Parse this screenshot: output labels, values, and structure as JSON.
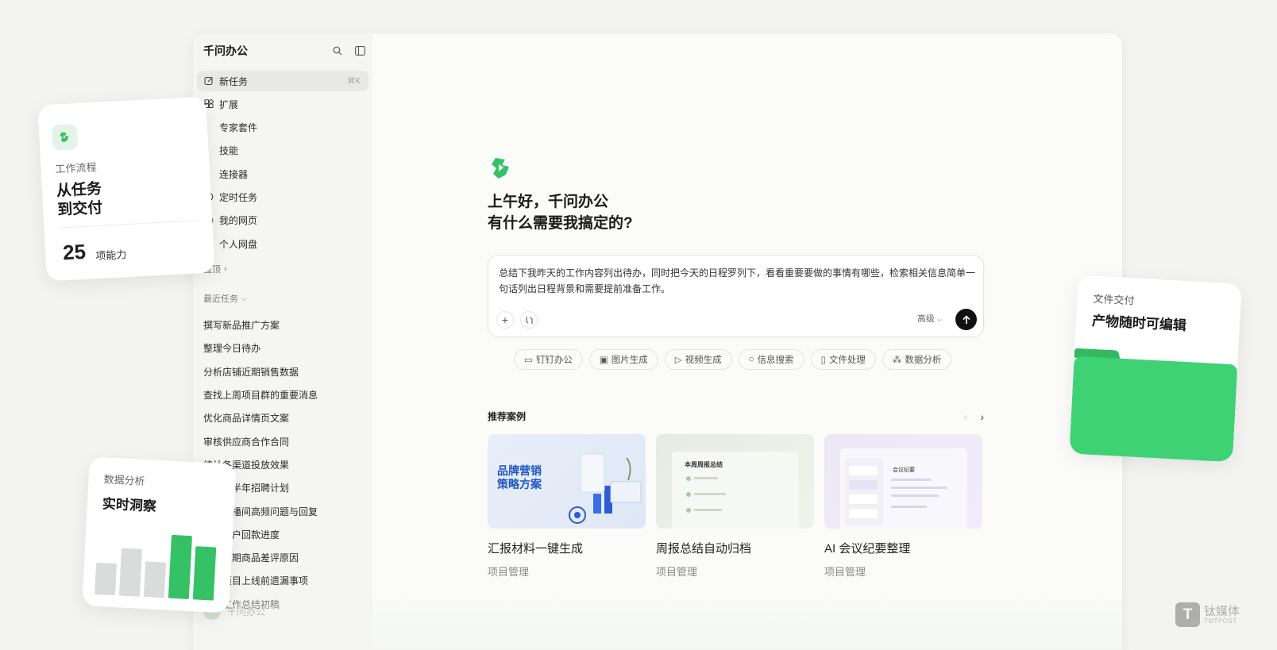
{
  "app": {
    "title": "千问办公",
    "accent": "#36c167"
  },
  "sidebar": {
    "items": [
      {
        "label": "新任务",
        "shortcut": "⌘K",
        "icon": "edit-icon"
      },
      {
        "label": "扩展",
        "icon": "extension-icon"
      },
      {
        "label": "专家套件",
        "icon": "suite-icon"
      },
      {
        "label": "技能",
        "icon": "skill-icon"
      },
      {
        "label": "连接器",
        "icon": "connector-icon"
      },
      {
        "label": "定时任务",
        "icon": "clock-icon"
      },
      {
        "label": "我的网页",
        "icon": "globe-icon"
      },
      {
        "label": "个人网盘",
        "icon": "drive-icon"
      }
    ],
    "pinned_label": "置顶",
    "recent_label": "最近任务",
    "recent_tasks": [
      "撰写新品推广方案",
      "整理今日待办",
      "分析店铺近期销售数据",
      "查找上周项目群的重要消息",
      "优化商品详情页文案",
      "审核供应商合作合同",
      "统计各渠道投放效果",
      "制定下半年招聘计划",
      "整理直播间高频问题与回复",
      "盘点客户回款进度",
      "分析近期商品差评原因",
      "梳理项目上线前遗漏事项",
      "季度工作总结初稿"
    ],
    "user_name": "千问办公"
  },
  "main": {
    "greeting_line1": "上午好，千问办公",
    "greeting_line2": "有什么需要我搞定的?",
    "composer_text": "总结下我昨天的工作内容列出待办，同时把今天的日程罗列下，看看重要要做的事情有哪些，检索相关信息简单一句话列出日程背景和需要提前准备工作。",
    "advanced_label": "高级",
    "chips": [
      {
        "label": "钉钉办公",
        "icon": "laptop-icon"
      },
      {
        "label": "图片生成",
        "icon": "image-icon"
      },
      {
        "label": "视频生成",
        "icon": "video-icon"
      },
      {
        "label": "信息搜索",
        "icon": "search-icon"
      },
      {
        "label": "文件处理",
        "icon": "file-icon"
      },
      {
        "label": "数据分析",
        "icon": "chart-icon"
      }
    ],
    "recommend_title": "推荐案例",
    "cases": [
      {
        "title": "汇报材料一键生成",
        "category": "项目管理",
        "thumb_text": "品牌营销\n策略方案"
      },
      {
        "title": "周报总结自动归档",
        "category": "项目管理",
        "thumb_text": "本周周报总结"
      },
      {
        "title": "AI 会议纪要整理",
        "category": "项目管理",
        "thumb_text": "会议纪要"
      }
    ]
  },
  "floating": {
    "workflow": {
      "eyebrow": "工作流程",
      "line1": "从任务",
      "line2": "到交付",
      "count": "25",
      "unit": "项能力"
    },
    "data": {
      "eyebrow": "数据分析",
      "title": "实时洞察",
      "bars": [
        0.5,
        0.75,
        0.56,
        1.0,
        0.84
      ]
    },
    "file": {
      "eyebrow": "文件交付",
      "title": "产物随时可编辑"
    }
  },
  "watermark": {
    "name": "钛媒体",
    "sub": "TMTPOST",
    "logo_letter": "T"
  }
}
